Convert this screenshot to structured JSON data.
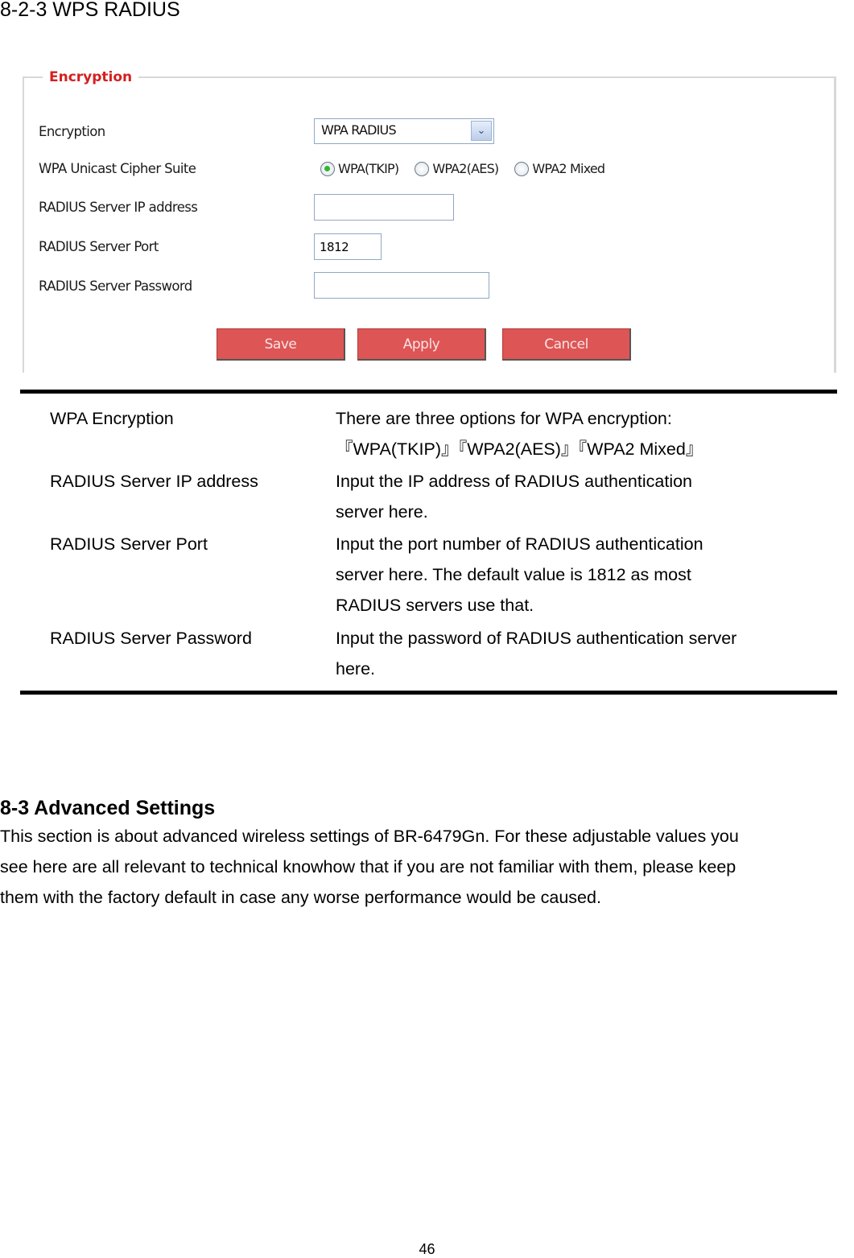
{
  "section_title": "8-2-3 WPS RADIUS",
  "screenshot": {
    "group_title": "Encryption",
    "accent_color": "#d51f1f",
    "fields": {
      "encryption": {
        "label": "Encryption",
        "selected": "WPA RADIUS"
      },
      "cipher_suite": {
        "label": "WPA Unicast Cipher Suite",
        "options": [
          {
            "label": "WPA(TKIP)",
            "checked": true
          },
          {
            "label": "WPA2(AES)",
            "checked": false
          },
          {
            "label": "WPA2 Mixed",
            "checked": false
          }
        ]
      },
      "server_ip": {
        "label": "RADIUS Server IP address",
        "value": ""
      },
      "server_port": {
        "label": "RADIUS Server Port",
        "value": "1812"
      },
      "server_password": {
        "label": "RADIUS Server Password",
        "value": ""
      }
    },
    "buttons": {
      "save": "Save",
      "apply": "Apply",
      "cancel": "Cancel"
    },
    "button_color": "#dd5555"
  },
  "descriptions": [
    {
      "term": "WPA Encryption",
      "lines": [
        "There are three options for WPA encryption:",
        "『WPA(TKIP)』『WPA2(AES)』『WPA2 Mixed』"
      ]
    },
    {
      "term": "RADIUS Server IP address",
      "lines": [
        "Input the IP address of RADIUS authentication",
        "server here."
      ]
    },
    {
      "term": "RADIUS Server Port",
      "lines": [
        "Input the port number of RADIUS authentication",
        "server here. The default value is 1812 as most",
        "RADIUS servers use that."
      ]
    },
    {
      "term": "RADIUS Server Password",
      "lines": [
        "Input the password of RADIUS authentication server",
        "here."
      ]
    }
  ],
  "advanced": {
    "heading": "8-3 Advanced Settings",
    "lines": [
      "This section is about advanced wireless settings of BR-6479Gn. For these adjustable values you",
      "see here are all relevant to technical knowhow that if you are not familiar with them, please keep",
      "them with the factory default in case any worse performance would be caused."
    ]
  },
  "page_number": "46"
}
